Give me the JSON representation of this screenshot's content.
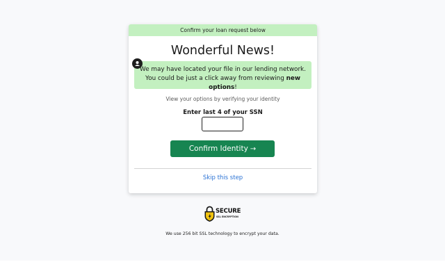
{
  "card": {
    "header": "Confirm your loan request below",
    "title": "Wonderful News!",
    "notice": {
      "text_before": "We may have located your file in our lending network. You could be just a click away from reviewing ",
      "highlight": "new options",
      "text_after": "!"
    },
    "subtitle": "View your options by verifying your identity",
    "ssn_label": "Enter last 4 of your SSN",
    "ssn_value": "",
    "confirm_label": "Confirm Identity",
    "confirm_arrow": "→",
    "skip_label": "Skip this step"
  },
  "badge": {
    "title": "SECURE",
    "subtitle": "SSL ENCRYPTION",
    "icon": "padlock-shield-icon"
  },
  "footer": {
    "text": "We use 256 bit SSL technology to encrypt your data."
  },
  "colors": {
    "accent_green": "#178551",
    "notice_green": "#c3f0c0",
    "link_blue": "#2a72d4",
    "badge_yellow": "#f2c40f"
  }
}
